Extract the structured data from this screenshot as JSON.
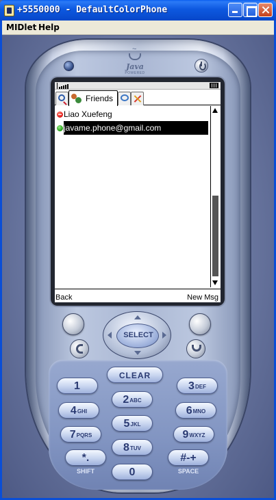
{
  "window": {
    "title": "+5550000 - DefaultColorPhone"
  },
  "menubar": {
    "items": [
      {
        "label": "MIDlet"
      },
      {
        "label": "Help"
      }
    ]
  },
  "branding": {
    "logo_text": "Java",
    "logo_subtext": "POWERED"
  },
  "screen": {
    "tabs": [
      {
        "icon": "search-icon"
      },
      {
        "icon": "friends-icon",
        "label": "Friends",
        "selected": true
      },
      {
        "icon": "chat-icon"
      },
      {
        "icon": "tools-icon"
      }
    ],
    "friends": [
      {
        "name": "Liao Xuefeng",
        "status": "busy",
        "selected": false
      },
      {
        "name": "javame.phone@gmail.com",
        "status": "online",
        "selected": true
      }
    ],
    "softkeys": {
      "left": "Back",
      "right": "New Msg"
    }
  },
  "keypad": {
    "select_label": "SELECT",
    "clear_label": "CLEAR",
    "keys": {
      "k1": {
        "num": "1",
        "letters": ""
      },
      "k2": {
        "num": "2",
        "letters": "ABC"
      },
      "k3": {
        "num": "3",
        "letters": "DEF"
      },
      "k4": {
        "num": "4",
        "letters": "GHI"
      },
      "k5": {
        "num": "5",
        "letters": "JKL"
      },
      "k6": {
        "num": "6",
        "letters": "MNO"
      },
      "k7": {
        "num": "7",
        "letters": "PQRS"
      },
      "k8": {
        "num": "8",
        "letters": "TUV"
      },
      "k9": {
        "num": "9",
        "letters": "WXYZ"
      },
      "kstar": {
        "num": "*.",
        "letters": ""
      },
      "k0": {
        "num": "0",
        "letters": ""
      },
      "khash": {
        "num": "#-+",
        "letters": ""
      }
    },
    "shift_label": "SHIFT",
    "space_label": "SPACE"
  },
  "colors": {
    "titlebar": "#0747c9",
    "selection": "#000000",
    "status_busy": "#dd1111",
    "status_online": "#1f9a10"
  }
}
